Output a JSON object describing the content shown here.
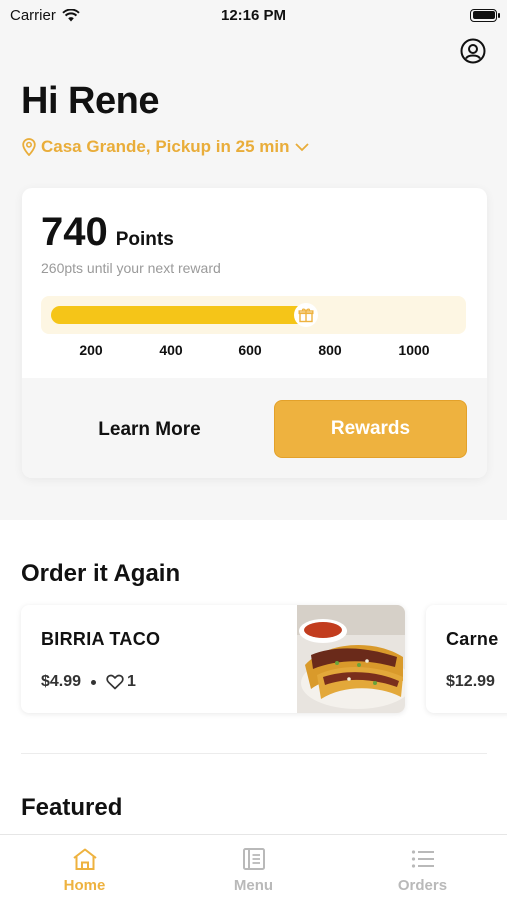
{
  "status_bar": {
    "carrier": "Carrier",
    "time": "12:16 PM"
  },
  "header": {
    "greeting": "Hi Rene",
    "location": "Casa Grande, Pickup in 25 min"
  },
  "points_card": {
    "points": "740",
    "points_label": "Points",
    "subtitle": "260pts until your next reward",
    "progress_fraction": 0.63,
    "ticks": [
      "200",
      "400",
      "600",
      "800",
      "1000"
    ],
    "learn_more_label": "Learn More",
    "rewards_label": "Rewards"
  },
  "order_again": {
    "title": "Order it Again",
    "items": [
      {
        "name": "BIRRIA TACO",
        "price": "$4.99",
        "likes": "1"
      },
      {
        "name": "Carne",
        "price": "$12.99"
      }
    ]
  },
  "featured": {
    "title": "Featured"
  },
  "tab_bar": {
    "tabs": [
      {
        "label": "Home",
        "icon": "home-icon"
      },
      {
        "label": "Menu",
        "icon": "menu-book-icon"
      },
      {
        "label": "Orders",
        "icon": "list-icon"
      }
    ]
  },
  "colors": {
    "accent": "#eeb23f",
    "progress": "#f5c518",
    "location": "#e9ad3a"
  }
}
